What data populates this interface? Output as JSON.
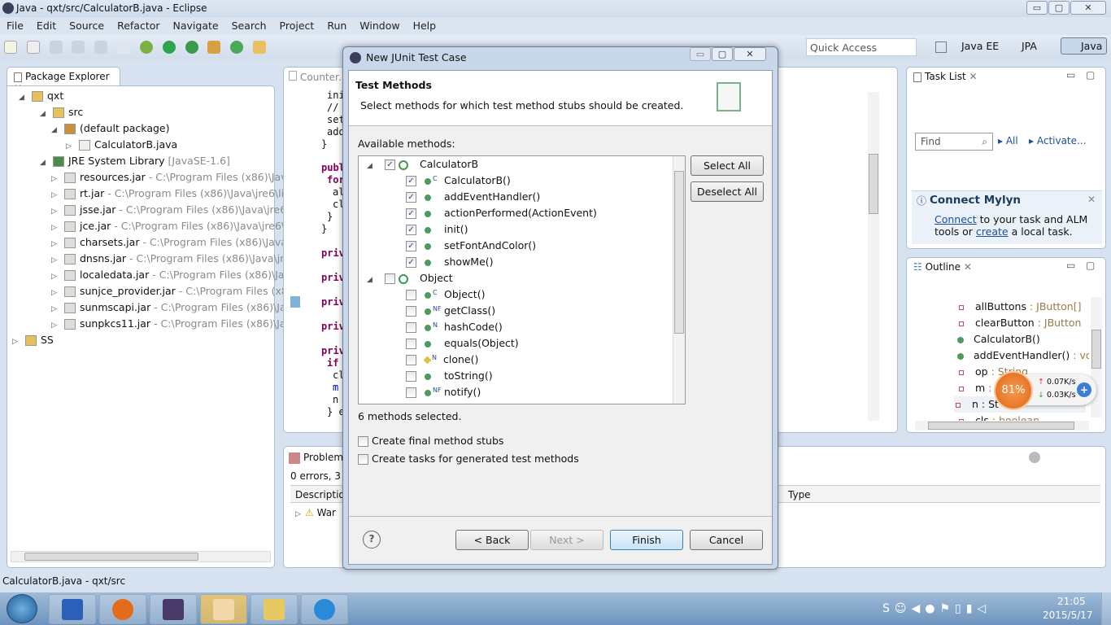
{
  "window": {
    "title": "Java - qxt/src/CalculatorB.java - Eclipse",
    "min": "▭",
    "max": "▢",
    "close": "✕"
  },
  "menu": [
    "File",
    "Edit",
    "Source",
    "Refactor",
    "Navigate",
    "Search",
    "Project",
    "Run",
    "Window",
    "Help"
  ],
  "quick_access": {
    "placeholder": "Quick Access"
  },
  "perspectives": [
    "Java EE",
    "JPA",
    "Java"
  ],
  "package_explorer": {
    "title": "Package Explorer",
    "items": [
      {
        "label": "qxt",
        "detail": ""
      },
      {
        "label": "src",
        "detail": ""
      },
      {
        "label": "(default package)",
        "detail": ""
      },
      {
        "label": "CalculatorB.java",
        "detail": ""
      },
      {
        "label": "JRE System Library",
        "detail": "[JavaSE-1.6]"
      },
      {
        "label": "resources.jar",
        "detail": "- C:\\Program Files (x86)\\Jav"
      },
      {
        "label": "rt.jar",
        "detail": "- C:\\Program Files (x86)\\Java\\jre6\\lil"
      },
      {
        "label": "jsse.jar",
        "detail": "- C:\\Program Files (x86)\\Java\\jre6"
      },
      {
        "label": "jce.jar",
        "detail": "- C:\\Program Files (x86)\\Java\\jre6\\l"
      },
      {
        "label": "charsets.jar",
        "detail": "- C:\\Program Files (x86)\\Java"
      },
      {
        "label": "dnsns.jar",
        "detail": "- C:\\Program Files (x86)\\Java\\jre"
      },
      {
        "label": "localedata.jar",
        "detail": "- C:\\Program Files (x86)\\Jav"
      },
      {
        "label": "sunjce_provider.jar",
        "detail": "- C:\\Program Files (x8"
      },
      {
        "label": "sunmscapi.jar",
        "detail": "- C:\\Program Files (x86)\\Ja"
      },
      {
        "label": "sunpkcs11.jar",
        "detail": "- C:\\Program Files (x86)\\Ja"
      },
      {
        "label": "SS",
        "detail": ""
      }
    ]
  },
  "editor": {
    "tab": "Counter.",
    "lines": [
      "ini",
      "//",
      "set",
      "add",
      "}",
      "publ",
      "for",
      "al",
      "cl",
      "}",
      "}",
      "priv",
      "priv",
      "priv",
      "priv",
      "priv",
      "if",
      "cl",
      "m",
      "n",
      "} e"
    ]
  },
  "problems": {
    "title": "Problems",
    "summary": "0 errors, 3",
    "col_description": "Descriptio",
    "col_type": "Type",
    "row": "War"
  },
  "task_list": {
    "title": "Task List",
    "find_placeholder": "Find",
    "all": "All",
    "activate": "Activate..."
  },
  "mylyn": {
    "title": "Connect Mylyn",
    "connect": "Connect",
    "text1": " to your task and ALM",
    "text2": "tools or ",
    "create": "create",
    "text3": " a local task."
  },
  "outline": {
    "title": "Outline",
    "items": [
      {
        "name": "allButtons",
        "type": " : JButton[]"
      },
      {
        "name": "clearButton",
        "type": " : JButton"
      },
      {
        "name": "CalculatorB()",
        "type": ""
      },
      {
        "name": "addEventHandler()",
        "type": " : voi"
      },
      {
        "name": "op",
        "type": " : String"
      },
      {
        "name": "m",
        "type": " : "
      },
      {
        "name": "n : St",
        "type": ""
      },
      {
        "name": "cls",
        "type": " : boolean"
      }
    ]
  },
  "net_widget": {
    "percent": "81%",
    "up": "0.07K/s",
    "down": "0.03K/s"
  },
  "dialog": {
    "title": "New JUnit Test Case",
    "header_title": "Test Methods",
    "header_desc": "Select methods for which test method stubs should be created.",
    "available_label": "Available methods:",
    "groups": [
      {
        "name": "CalculatorB",
        "checked": true,
        "methods": [
          {
            "name": "CalculatorB()",
            "mod": "C",
            "checked": true
          },
          {
            "name": "addEventHandler()",
            "mod": "",
            "checked": true
          },
          {
            "name": "actionPerformed(ActionEvent)",
            "mod": "",
            "checked": true
          },
          {
            "name": "init()",
            "mod": "",
            "checked": true
          },
          {
            "name": "setFontAndColor()",
            "mod": "",
            "checked": true
          },
          {
            "name": "showMe()",
            "mod": "",
            "checked": true
          }
        ]
      },
      {
        "name": "Object",
        "checked": false,
        "methods": [
          {
            "name": "Object()",
            "mod": "C",
            "checked": false
          },
          {
            "name": "getClass()",
            "mod": "NF",
            "checked": false
          },
          {
            "name": "hashCode()",
            "mod": "N",
            "checked": false
          },
          {
            "name": "equals(Object)",
            "mod": "",
            "checked": false
          },
          {
            "name": "clone()",
            "mod": "N",
            "checked": false,
            "protected": true
          },
          {
            "name": "toString()",
            "mod": "",
            "checked": false
          },
          {
            "name": "notify()",
            "mod": "NF",
            "checked": false
          }
        ]
      }
    ],
    "select_all": "Select All",
    "deselect_all": "Deselect All",
    "count": "6 methods selected.",
    "opt_final": "Create final method stubs",
    "opt_tasks": "Create tasks for generated test methods",
    "back": "< Back",
    "next": "Next >",
    "finish": "Finish",
    "cancel": "Cancel",
    "help": "?"
  },
  "status": {
    "text": "CalculatorB.java - qxt/src"
  },
  "taskbar": {
    "apps": [
      "word-app",
      "firefox-app",
      "javaee-ide-app",
      "photo-app",
      "explorer-app",
      "ie-app"
    ],
    "time": "21:05",
    "date": "2015/5/17"
  },
  "colors": {
    "accent": "#3c7fb1",
    "method_public": "#4c9a5c",
    "badge": "#f07f2a"
  }
}
